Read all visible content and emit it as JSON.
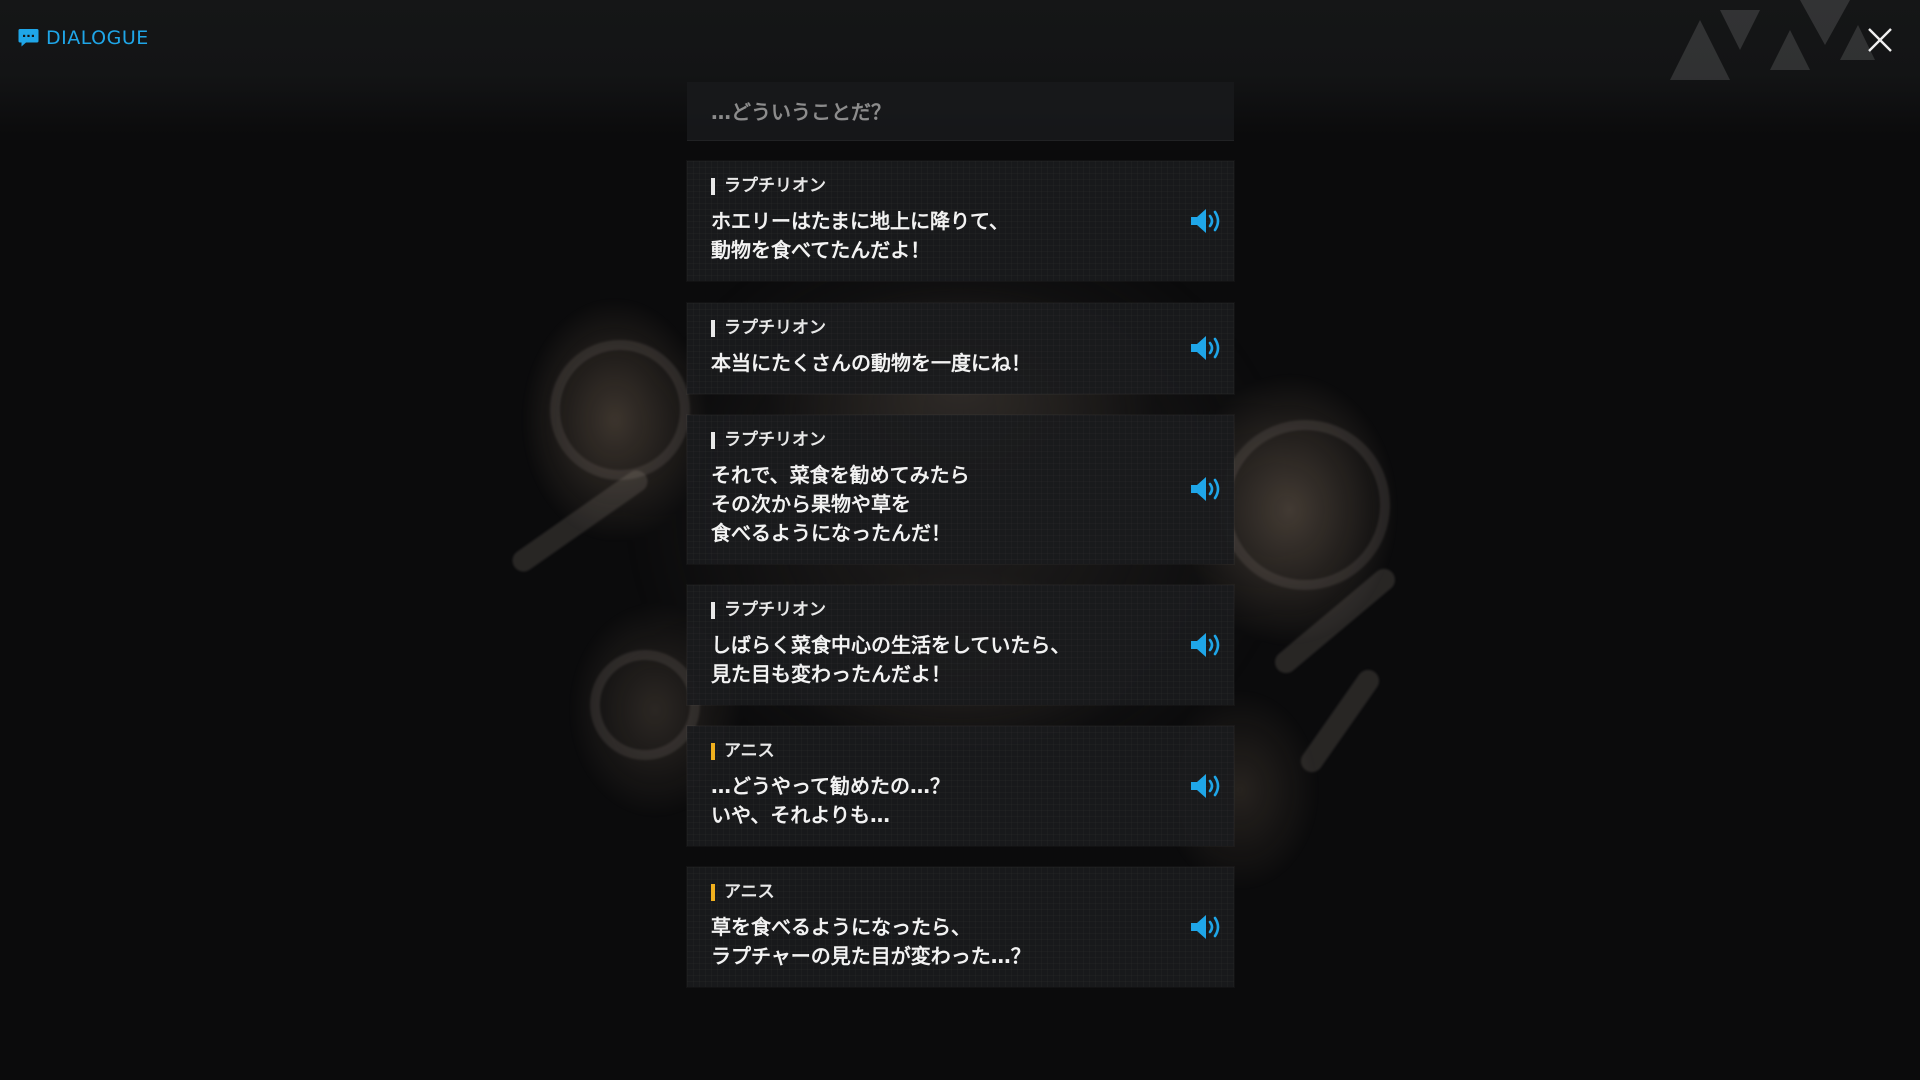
{
  "header": {
    "title": "DIALOGUE",
    "title_icon": "chat-bubble-icon",
    "close_icon": "close-icon"
  },
  "colors": {
    "accent": "#1fa6e8",
    "speaker_marker_default": "#e9e9e9",
    "speaker_marker_highlight": "#f0b01e",
    "panel": "#1a1b1d",
    "text": "#f2f2f2"
  },
  "dialogue": {
    "previous_line": "…どういうことだ？",
    "entries": [
      {
        "speaker": "ラプチリオン",
        "lines": [
          "ホエリーはたまに地上に降りて、",
          "動物を食べてたんだよ！"
        ],
        "voice_icon": "speaker-icon"
      },
      {
        "speaker": "ラプチリオン",
        "lines": [
          "本当にたくさんの動物を一度にね！"
        ],
        "voice_icon": "speaker-icon"
      },
      {
        "speaker": "ラプチリオン",
        "lines": [
          "それで、菜食を勧めてみたら",
          "その次から果物や草を",
          "食べるようになったんだ！"
        ],
        "voice_icon": "speaker-icon"
      },
      {
        "speaker": "ラプチリオン",
        "lines": [
          "しばらく菜食中心の生活をしていたら、",
          "見た目も変わったんだよ！"
        ],
        "voice_icon": "speaker-icon"
      },
      {
        "speaker": "アニス",
        "lines": [
          "…どうやって勧めたの…？",
          "いや、それよりも…"
        ],
        "voice_icon": "speaker-icon"
      },
      {
        "speaker": "アニス",
        "lines": [
          "草を食べるようになったら、",
          "ラプチャーの見た目が変わった…？"
        ],
        "voice_icon": "speaker-icon"
      }
    ]
  }
}
